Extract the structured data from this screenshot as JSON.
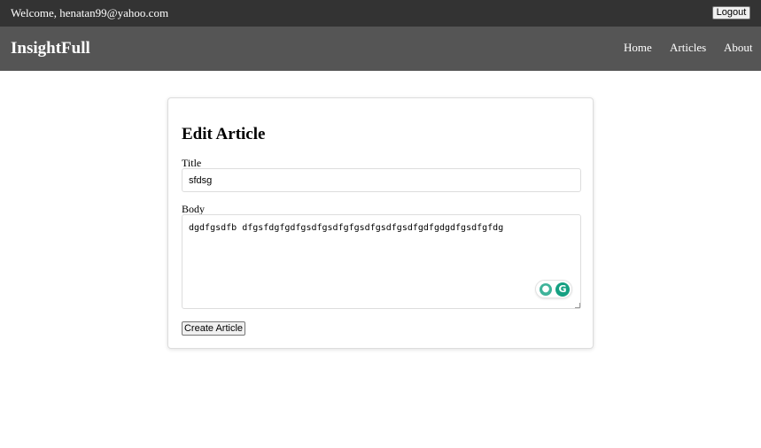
{
  "topbar": {
    "welcome_text": "Welcome, henatan99@yahoo.com",
    "logout_label": "Logout"
  },
  "navbar": {
    "brand": "InsightFull",
    "links": [
      {
        "label": "Home"
      },
      {
        "label": "Articles"
      },
      {
        "label": "About"
      }
    ]
  },
  "form": {
    "heading": "Edit Article",
    "title_label": "Title",
    "title_value": "sfdsg",
    "body_label": "Body",
    "body_value": "dgdfgsdfb dfgsfdgfgdfgsdfgsdfgfgsdfgsdfgsdfgdfgdgdfgsdfgfdg",
    "submit_label": "Create Article"
  },
  "extension": {
    "idea_icon": "lightbulb-icon",
    "logo_icon": "grammarly-icon",
    "logo_glyph": "G",
    "idea_glyph": "💡"
  },
  "colors": {
    "topbar_bg": "#333333",
    "navbar_bg": "#555555",
    "grammarly_green": "#15a082"
  }
}
